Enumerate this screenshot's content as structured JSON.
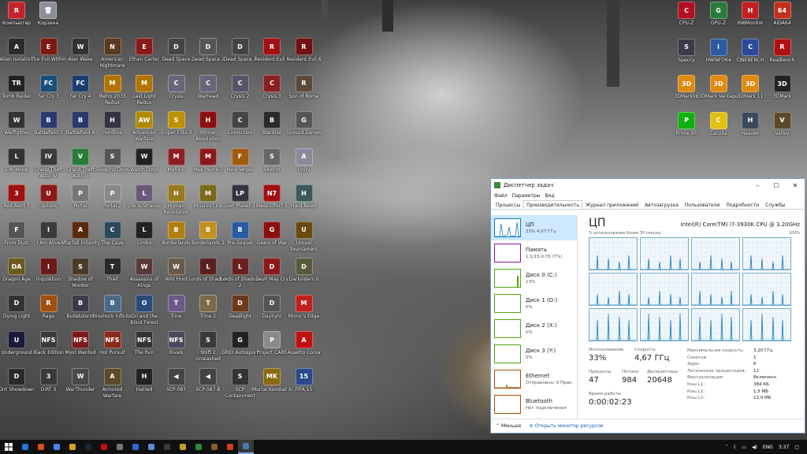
{
  "desktop": {
    "icons": [
      {
        "label": "Компьютер",
        "color": "#c4232b",
        "glyph": "R",
        "icon": "computer-icon"
      },
      {
        "label": "Корзина",
        "color": "#8a8f99",
        "glyph": "🗑",
        "icon": "recycle-bin-icon"
      },
      {
        "label": "Alien Isolation",
        "color": "#2b2b2b",
        "glyph": "A",
        "icon": "game-icon"
      },
      {
        "label": "The Evil Within",
        "color": "#7a1a10",
        "glyph": "E",
        "icon": "game-icon"
      },
      {
        "label": "Alan Wake",
        "color": "#333",
        "glyph": "W",
        "icon": "game-icon"
      },
      {
        "label": "American Nightmare",
        "color": "#5a3a20",
        "glyph": "N",
        "icon": "game-icon"
      },
      {
        "label": "Ethan Carter",
        "color": "#8a1a1a",
        "glyph": "E",
        "icon": "game-icon"
      },
      {
        "label": "Dead Space",
        "color": "#444",
        "glyph": "D",
        "icon": "game-icon"
      },
      {
        "label": "Dead Space 2",
        "color": "#555",
        "glyph": "D",
        "icon": "game-icon"
      },
      {
        "label": "Dead Space 3",
        "color": "#444",
        "glyph": "D",
        "icon": "game-icon"
      },
      {
        "label": "Resident Evil 5",
        "color": "#a01010",
        "glyph": "R",
        "icon": "game-icon"
      },
      {
        "label": "Resident Evil 6",
        "color": "#701010",
        "glyph": "R",
        "icon": "game-icon"
      },
      {
        "label": "Tomb Raider",
        "color": "#222",
        "glyph": "TR",
        "icon": "game-icon"
      },
      {
        "label": "Far Cry 3",
        "color": "#1a4d7a",
        "glyph": "FC",
        "icon": "game-icon"
      },
      {
        "label": "Far Cry 4",
        "color": "#1a3d6a",
        "glyph": "FC",
        "icon": "game-icon"
      },
      {
        "label": "Metro 2033 Redux",
        "color": "#b27300",
        "glyph": "M",
        "icon": "game-icon"
      },
      {
        "label": "Last Light Redux",
        "color": "#b27300",
        "glyph": "M",
        "icon": "game-icon"
      },
      {
        "label": "Crysis",
        "color": "#667",
        "glyph": "C",
        "icon": "game-icon"
      },
      {
        "label": "Warhead",
        "color": "#667",
        "glyph": "C",
        "icon": "game-icon"
      },
      {
        "label": "Crysis 2",
        "color": "#556",
        "glyph": "C",
        "icon": "game-icon"
      },
      {
        "label": "Crysis 3",
        "color": "#8a2020",
        "glyph": "C",
        "icon": "game-icon"
      },
      {
        "label": "Son of Rome",
        "color": "#5a4a3a",
        "glyph": "R",
        "icon": "game-icon"
      },
      {
        "label": "Warfighter",
        "color": "#333",
        "glyph": "W",
        "icon": "game-icon"
      },
      {
        "label": "Battlefield 3",
        "color": "#2a3a6a",
        "glyph": "B",
        "icon": "game-icon"
      },
      {
        "label": "Battlefield 4",
        "color": "#2a3a6a",
        "glyph": "B",
        "icon": "game-icon"
      },
      {
        "label": "Hardline",
        "color": "#334",
        "glyph": "H",
        "icon": "game-icon"
      },
      {
        "label": "Advanced Warfare",
        "color": "#b08a00",
        "glyph": "AW",
        "icon": "game-icon"
      },
      {
        "label": "Sniper Elite 3",
        "color": "#c09000",
        "glyph": "S",
        "icon": "game-icon"
      },
      {
        "label": "Hitman Absolution",
        "color": "#8a1010",
        "glyph": "H",
        "icon": "game-icon"
      },
      {
        "label": "Conviction",
        "color": "#444",
        "glyph": "C",
        "icon": "game-icon"
      },
      {
        "label": "Blacklist",
        "color": "#2a2a2a",
        "glyph": "B",
        "icon": "game-icon"
      },
      {
        "label": "Ground Zeroes",
        "color": "#555",
        "glyph": "G",
        "icon": "game-icon"
      },
      {
        "label": "L.A. Noire",
        "color": "#333",
        "glyph": "L",
        "icon": "game-icon"
      },
      {
        "label": "Grand Theft Auto IV",
        "color": "#3a3a3a",
        "glyph": "IV",
        "icon": "game-icon"
      },
      {
        "label": "Grand Theft Auto V",
        "color": "#2a7a3a",
        "glyph": "V",
        "icon": "game-icon"
      },
      {
        "label": "Sleeping Dogs",
        "color": "#555",
        "glyph": "S",
        "icon": "game-icon"
      },
      {
        "label": "Watch Dogs",
        "color": "#222",
        "glyph": "W",
        "icon": "game-icon"
      },
      {
        "label": "Mafia II",
        "color": "#8a2020",
        "glyph": "M",
        "icon": "game-icon"
      },
      {
        "label": "Max Payne 3",
        "color": "#8a1a1a",
        "glyph": "M",
        "icon": "game-icon"
      },
      {
        "label": "New Vegas",
        "color": "#a05a10",
        "glyph": "F",
        "icon": "game-icon"
      },
      {
        "label": "Skyrim",
        "color": "#666",
        "glyph": "S",
        "icon": "game-icon"
      },
      {
        "label": "Unity",
        "color": "#8a8a9a",
        "glyph": "A",
        "icon": "game-icon"
      },
      {
        "label": "Red Alert 3",
        "color": "#a01010",
        "glyph": "3",
        "icon": "game-icon"
      },
      {
        "label": "Uprising",
        "color": "#8a1a1a",
        "glyph": "U",
        "icon": "game-icon"
      },
      {
        "label": "Portal",
        "color": "#777",
        "glyph": "P",
        "icon": "game-icon"
      },
      {
        "label": "Portal 2",
        "color": "#888",
        "glyph": "P",
        "icon": "game-icon"
      },
      {
        "label": "Life is Strange",
        "color": "#6a5a7a",
        "glyph": "L",
        "icon": "game-icon"
      },
      {
        "label": "Human Revolution",
        "color": "#9a7a20",
        "glyph": "H",
        "icon": "game-icon"
      },
      {
        "label": "Missing Link",
        "color": "#7a6a20",
        "glyph": "M",
        "icon": "game-icon"
      },
      {
        "label": "Lost Planet 3",
        "color": "#334",
        "glyph": "LP",
        "icon": "game-icon"
      },
      {
        "label": "Mass Effect 3",
        "color": "#a01010",
        "glyph": "N7",
        "icon": "game-icon"
      },
      {
        "label": "Hard Reset",
        "color": "#3a5a5a",
        "glyph": "H",
        "icon": "game-icon"
      },
      {
        "label": "From Dust",
        "color": "#555",
        "glyph": "F",
        "icon": "game-icon"
      },
      {
        "label": "I Am Alive",
        "color": "#3a3a3a",
        "glyph": "I",
        "icon": "game-icon"
      },
      {
        "label": "Afterfall InSanity",
        "color": "#5a2a10",
        "glyph": "A",
        "icon": "game-icon"
      },
      {
        "label": "The Cave",
        "color": "#2a4a5a",
        "glyph": "C",
        "icon": "game-icon"
      },
      {
        "label": "Limbo",
        "color": "#222",
        "glyph": "L",
        "icon": "game-icon"
      },
      {
        "label": "Borderlands",
        "color": "#b08010",
        "glyph": "B",
        "icon": "game-icon"
      },
      {
        "label": "Borderlands 2",
        "color": "#c09020",
        "glyph": "B",
        "icon": "game-icon"
      },
      {
        "label": "Pre-Sequel",
        "color": "#2a5aa0",
        "glyph": "B",
        "icon": "game-icon"
      },
      {
        "label": "Gears of War",
        "color": "#8a1010",
        "glyph": "G",
        "icon": "game-icon"
      },
      {
        "label": "Unreal Tournament",
        "color": "#6a4a10",
        "glyph": "U",
        "icon": "game-icon"
      },
      {
        "label": "Dragon Age",
        "color": "#6a5a20",
        "glyph": "DA",
        "icon": "game-icon"
      },
      {
        "label": "Inquisition",
        "color": "#6a1a1a",
        "glyph": "I",
        "icon": "game-icon"
      },
      {
        "label": "Shadow of Mordor",
        "color": "#4a3a2a",
        "glyph": "S",
        "icon": "game-icon"
      },
      {
        "label": "Thief",
        "color": "#2a2a2a",
        "glyph": "T",
        "icon": "game-icon"
      },
      {
        "label": "Assassins of Kings",
        "color": "#5a3a3a",
        "glyph": "W",
        "icon": "game-icon"
      },
      {
        "label": "Wild Hunt",
        "color": "#6a5a4a",
        "glyph": "W",
        "icon": "game-icon"
      },
      {
        "label": "Lords of Shadow",
        "color": "#5a2020",
        "glyph": "L",
        "icon": "game-icon"
      },
      {
        "label": "Lords of Shadow 2",
        "color": "#6a2020",
        "glyph": "L",
        "icon": "game-icon"
      },
      {
        "label": "Devil May Cry",
        "color": "#8a1a1a",
        "glyph": "D",
        "icon": "game-icon"
      },
      {
        "label": "Darksiders II",
        "color": "#5a5a3a",
        "glyph": "D",
        "icon": "game-icon"
      },
      {
        "label": "Dying Light",
        "color": "#333",
        "glyph": "D",
        "icon": "game-icon"
      },
      {
        "label": "Rage",
        "color": "#a05010",
        "glyph": "R",
        "icon": "game-icon"
      },
      {
        "label": "Bulletstorm",
        "color": "#3a3a4a",
        "glyph": "B",
        "icon": "game-icon"
      },
      {
        "label": "Bioshock Infinite",
        "color": "#4a6a8a",
        "glyph": "B",
        "icon": "game-icon"
      },
      {
        "label": "Ori and the Blind Forest",
        "color": "#2a4a7a",
        "glyph": "O",
        "icon": "game-icon"
      },
      {
        "label": "Trine",
        "color": "#6a5a8a",
        "glyph": "T",
        "icon": "game-icon"
      },
      {
        "label": "Trine 2",
        "color": "#7a6a4a",
        "glyph": "T",
        "icon": "game-icon"
      },
      {
        "label": "Deadlight",
        "color": "#6a3a1a",
        "glyph": "D",
        "icon": "game-icon"
      },
      {
        "label": "Daylight",
        "color": "#555",
        "glyph": "D",
        "icon": "game-icon"
      },
      {
        "label": "Mirror's Edge",
        "color": "#c02020",
        "glyph": "M",
        "icon": "game-icon"
      },
      {
        "label": "Underground",
        "color": "#1a1a3a",
        "glyph": "U",
        "icon": "game-icon"
      },
      {
        "label": "Black Edition",
        "color": "#3a3a3a",
        "glyph": "NFS",
        "icon": "game-icon"
      },
      {
        "label": "Most Wanted",
        "color": "#7a1a1a",
        "glyph": "NFS",
        "icon": "game-icon"
      },
      {
        "label": "Hot Pursuit",
        "color": "#8a2a1a",
        "glyph": "NFS",
        "icon": "game-icon"
      },
      {
        "label": "The Run",
        "color": "#333",
        "glyph": "NFS",
        "icon": "game-icon"
      },
      {
        "label": "Rivals",
        "color": "#4a4a5a",
        "glyph": "NFS",
        "icon": "game-icon"
      },
      {
        "label": "Shift 2 Unleashed",
        "color": "#3a3a3a",
        "glyph": "S",
        "icon": "game-icon"
      },
      {
        "label": "GRID Autosport",
        "color": "#222",
        "glyph": "G",
        "icon": "game-icon"
      },
      {
        "label": "Project CARS",
        "color": "#8a8a8a",
        "glyph": "P",
        "icon": "game-icon"
      },
      {
        "label": "Assetto Corsa",
        "color": "#c01010",
        "glyph": "A",
        "icon": "game-icon"
      },
      {
        "label": "Dirt Showdown",
        "color": "#2a2a2a",
        "glyph": "D",
        "icon": "game-icon"
      },
      {
        "label": "DiRT 3",
        "color": "#3a3a3a",
        "glyph": "3",
        "icon": "game-icon"
      },
      {
        "label": "WarThunder",
        "color": "#4a4a4a",
        "glyph": "W",
        "icon": "game-icon"
      },
      {
        "label": "Armored Warfare",
        "color": "#5a4a2a",
        "glyph": "A",
        "icon": "game-icon"
      },
      {
        "label": "Hatred",
        "color": "#222",
        "glyph": "H",
        "icon": "game-icon"
      },
      {
        "label": "SCP-087",
        "color": "#444",
        "glyph": "◀",
        "icon": "game-icon"
      },
      {
        "label": "SCP-087-B",
        "color": "#444",
        "glyph": "◀",
        "icon": "game-icon"
      },
      {
        "label": "SCP Containment Breach",
        "color": "#333",
        "glyph": "S",
        "icon": "game-icon"
      },
      {
        "label": "Mortal Kombat X",
        "color": "#8a6a10",
        "glyph": "MK",
        "icon": "game-icon"
      },
      {
        "label": "FIFA 15",
        "color": "#2a4a8a",
        "glyph": "15",
        "icon": "game-icon"
      },
      {
        "label": "CPU-Z",
        "color": "#b01020",
        "glyph": "C",
        "icon": "cpu-z-icon"
      },
      {
        "label": "GPU-Z",
        "color": "#2a7a3a",
        "glyph": "G",
        "icon": "gpu-z-icon"
      },
      {
        "label": "HWMonitor",
        "color": "#c02020",
        "glyph": "H",
        "icon": "hwmonitor-icon"
      },
      {
        "label": "AIDA64",
        "color": "#c03020",
        "glyph": "64",
        "icon": "aida64-icon"
      },
      {
        "label": "Speccy",
        "color": "#3a3a4a",
        "glyph": "S",
        "icon": "speccy-icon"
      },
      {
        "label": "HWiNFO64",
        "color": "#2a5aa0",
        "glyph": "i",
        "icon": "hwinfo-icon"
      },
      {
        "label": "CINEBENCH",
        "color": "#2a4a9a",
        "glyph": "C",
        "icon": "cinebench-icon"
      },
      {
        "label": "RealBench",
        "color": "#b01010",
        "glyph": "R",
        "icon": "realbench-icon"
      },
      {
        "label": "3DMark06",
        "color": "#e08a10",
        "glyph": "3D",
        "icon": "3dmark-icon"
      },
      {
        "label": "3DMark Vantage",
        "color": "#e08a10",
        "glyph": "3D",
        "icon": "3dmark-icon"
      },
      {
        "label": "3DMark 11",
        "color": "#e08a10",
        "glyph": "3D",
        "icon": "3dmark-icon"
      },
      {
        "label": "3DMark",
        "color": "#222",
        "glyph": "3D",
        "icon": "3dmark-icon"
      },
      {
        "label": "Prime 95",
        "color": "#10b010",
        "glyph": "P",
        "icon": "prime95-icon"
      },
      {
        "label": "Catzilla",
        "color": "#e0c010",
        "glyph": "C",
        "icon": "catzilla-icon"
      },
      {
        "label": "Heaven",
        "color": "#3a4a5a",
        "glyph": "H",
        "icon": "heaven-icon"
      },
      {
        "label": "Valley",
        "color": "#5a4a2a",
        "glyph": "V",
        "icon": "valley-icon"
      }
    ]
  },
  "taskmgr": {
    "title": "Диспетчер задач",
    "menu": [
      "Файл",
      "Параметры",
      "Вид"
    ],
    "tabs": [
      "Процессы",
      "Производительность",
      "Журнал приложений",
      "Автозагрузка",
      "Пользователи",
      "Подробности",
      "Службы"
    ],
    "side": [
      {
        "title": "ЦП",
        "sub": "33% 4,67 ГГц",
        "color": "#117dbb"
      },
      {
        "title": "Память",
        "sub": "1,1/15,9 ГБ (7%)",
        "color": "#8b12ae"
      },
      {
        "title": "Диск 0 (C:)",
        "sub": "13%",
        "color": "#4da60c"
      },
      {
        "title": "Диск 1 (D:)",
        "sub": "0%",
        "color": "#4da60c"
      },
      {
        "title": "Диск 2 (X:)",
        "sub": "0%",
        "color": "#4da60c"
      },
      {
        "title": "Диск 3 (Y:)",
        "sub": "0%",
        "color": "#4da60c"
      },
      {
        "title": "Ethernet",
        "sub": "Отправлено: 0 Прин",
        "color": "#a74f01"
      },
      {
        "title": "Bluetooth",
        "sub": "Нет подключения",
        "color": "#a74f01"
      }
    ],
    "cpu": {
      "heading": "ЦП",
      "model": "Intel(R) Core(TM) i7-3930K CPU @ 3.20GHz",
      "graph_label": "% использования более 30 секунд",
      "graph_max": "100%",
      "usage_label": "Использование",
      "usage": "33%",
      "speed_label": "Скорость",
      "speed": "4,67 ГГц",
      "proc_label": "Процессы",
      "proc": "47",
      "threads_label": "Потоки",
      "threads": "984",
      "handles_label": "Дескрипторы",
      "handles": "20648",
      "uptime_label": "Время работы",
      "uptime": "0:00:02:23",
      "kv": [
        [
          "Максимальная скорость:",
          "3,20 ГГц"
        ],
        [
          "Сокетов:",
          "1"
        ],
        [
          "Ядра:",
          "6"
        ],
        [
          "Логических процессоров:",
          "12"
        ],
        [
          "Виртуализация:",
          "Включено"
        ],
        [
          "Кэш L1:",
          "384 КБ"
        ],
        [
          "Кэш L2:",
          "1,5 МБ"
        ],
        [
          "Кэш L3:",
          "12,0 МБ"
        ]
      ]
    },
    "footer": {
      "less": "Меньше",
      "monitor": "Открыть монитор ресурсов"
    }
  },
  "taskbar": {
    "apps": [
      {
        "color": "#1e7ad6"
      },
      {
        "color": "#d94f1a"
      },
      {
        "color": "#4285f4"
      },
      {
        "color": "#d9a01a"
      },
      {
        "color": "#1b2838"
      },
      {
        "color": "#c21010"
      },
      {
        "color": "#777"
      },
      {
        "color": "#2a6ad6"
      },
      {
        "color": "#5a8ad6"
      },
      {
        "color": "#3a3a3a"
      },
      {
        "color": "#c0a020"
      },
      {
        "color": "#2a8a3a"
      },
      {
        "color": "#8a5a2a"
      },
      {
        "color": "#d04020"
      },
      {
        "color": "#4a7ab0"
      }
    ],
    "lang": "ENG",
    "time": "3:37"
  }
}
